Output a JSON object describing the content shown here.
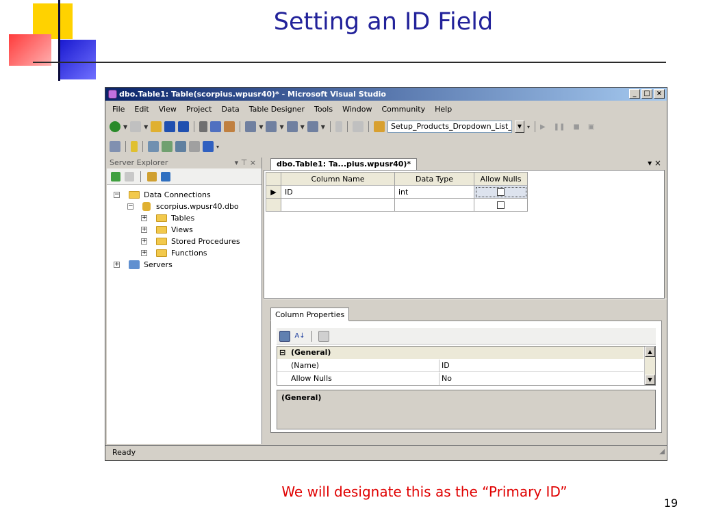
{
  "slide": {
    "title": "Setting an ID Field",
    "caption": "We will designate this as the “Primary ID”",
    "page_number": "19"
  },
  "window": {
    "title": "dbo.Table1: Table(scorpius.wpusr40)* - Microsoft Visual Studio",
    "buttons": {
      "minimize": "_",
      "maximize": "□",
      "close": "×"
    }
  },
  "menu": [
    "File",
    "Edit",
    "View",
    "Project",
    "Data",
    "Table Designer",
    "Tools",
    "Window",
    "Community",
    "Help"
  ],
  "toolbar": {
    "config_combo": "Setup_Products_Dropdown_List_f",
    "icon_colors": [
      "#2a8a2a",
      "#c0c0c0",
      "#e0b030",
      "#2050b0",
      "#2050b0",
      "#707070",
      "#5070c0",
      "#c08040",
      "#7080a0",
      "#7080a0",
      "#7080a0",
      "#7080a0",
      "#c0c0c0",
      "#c0c0c0",
      "#d8a030"
    ]
  },
  "server_explorer": {
    "title": "Server Explorer",
    "pin": "▾ ⊤ ×",
    "tree": [
      {
        "label": "Data Connections",
        "toggle": "−",
        "depth": 0,
        "icon": "database-folder-icon"
      },
      {
        "label": "scorpius.wpusr40.dbo",
        "toggle": "−",
        "depth": 1,
        "icon": "database-icon"
      },
      {
        "label": "Tables",
        "toggle": "+",
        "depth": 2,
        "icon": "folder-icon"
      },
      {
        "label": "Views",
        "toggle": "+",
        "depth": 2,
        "icon": "folder-icon"
      },
      {
        "label": "Stored Procedures",
        "toggle": "+",
        "depth": 2,
        "icon": "folder-icon"
      },
      {
        "label": "Functions",
        "toggle": "+",
        "depth": 2,
        "icon": "folder-icon"
      },
      {
        "label": "Servers",
        "toggle": "+",
        "depth": 0,
        "icon": "servers-icon"
      }
    ]
  },
  "designer": {
    "doc_tab": "dbo.Table1: Ta...pius.wpusr40)*",
    "doc_controls": "▾ ×",
    "columns": [
      "Column Name",
      "Data Type",
      "Allow Nulls"
    ],
    "rows": [
      {
        "name": "ID",
        "type": "int",
        "allow_nulls": false,
        "current": true
      },
      {
        "name": "",
        "type": "",
        "allow_nulls": false,
        "current": false
      }
    ]
  },
  "column_properties": {
    "tab_label": "Column Properties",
    "category": "(General)",
    "category_toggle": "⊟",
    "properties": [
      {
        "key": "(Name)",
        "value": "ID"
      },
      {
        "key": "Allow Nulls",
        "value": "No"
      }
    ],
    "description_title": "(General)"
  },
  "status": {
    "text": "Ready"
  }
}
